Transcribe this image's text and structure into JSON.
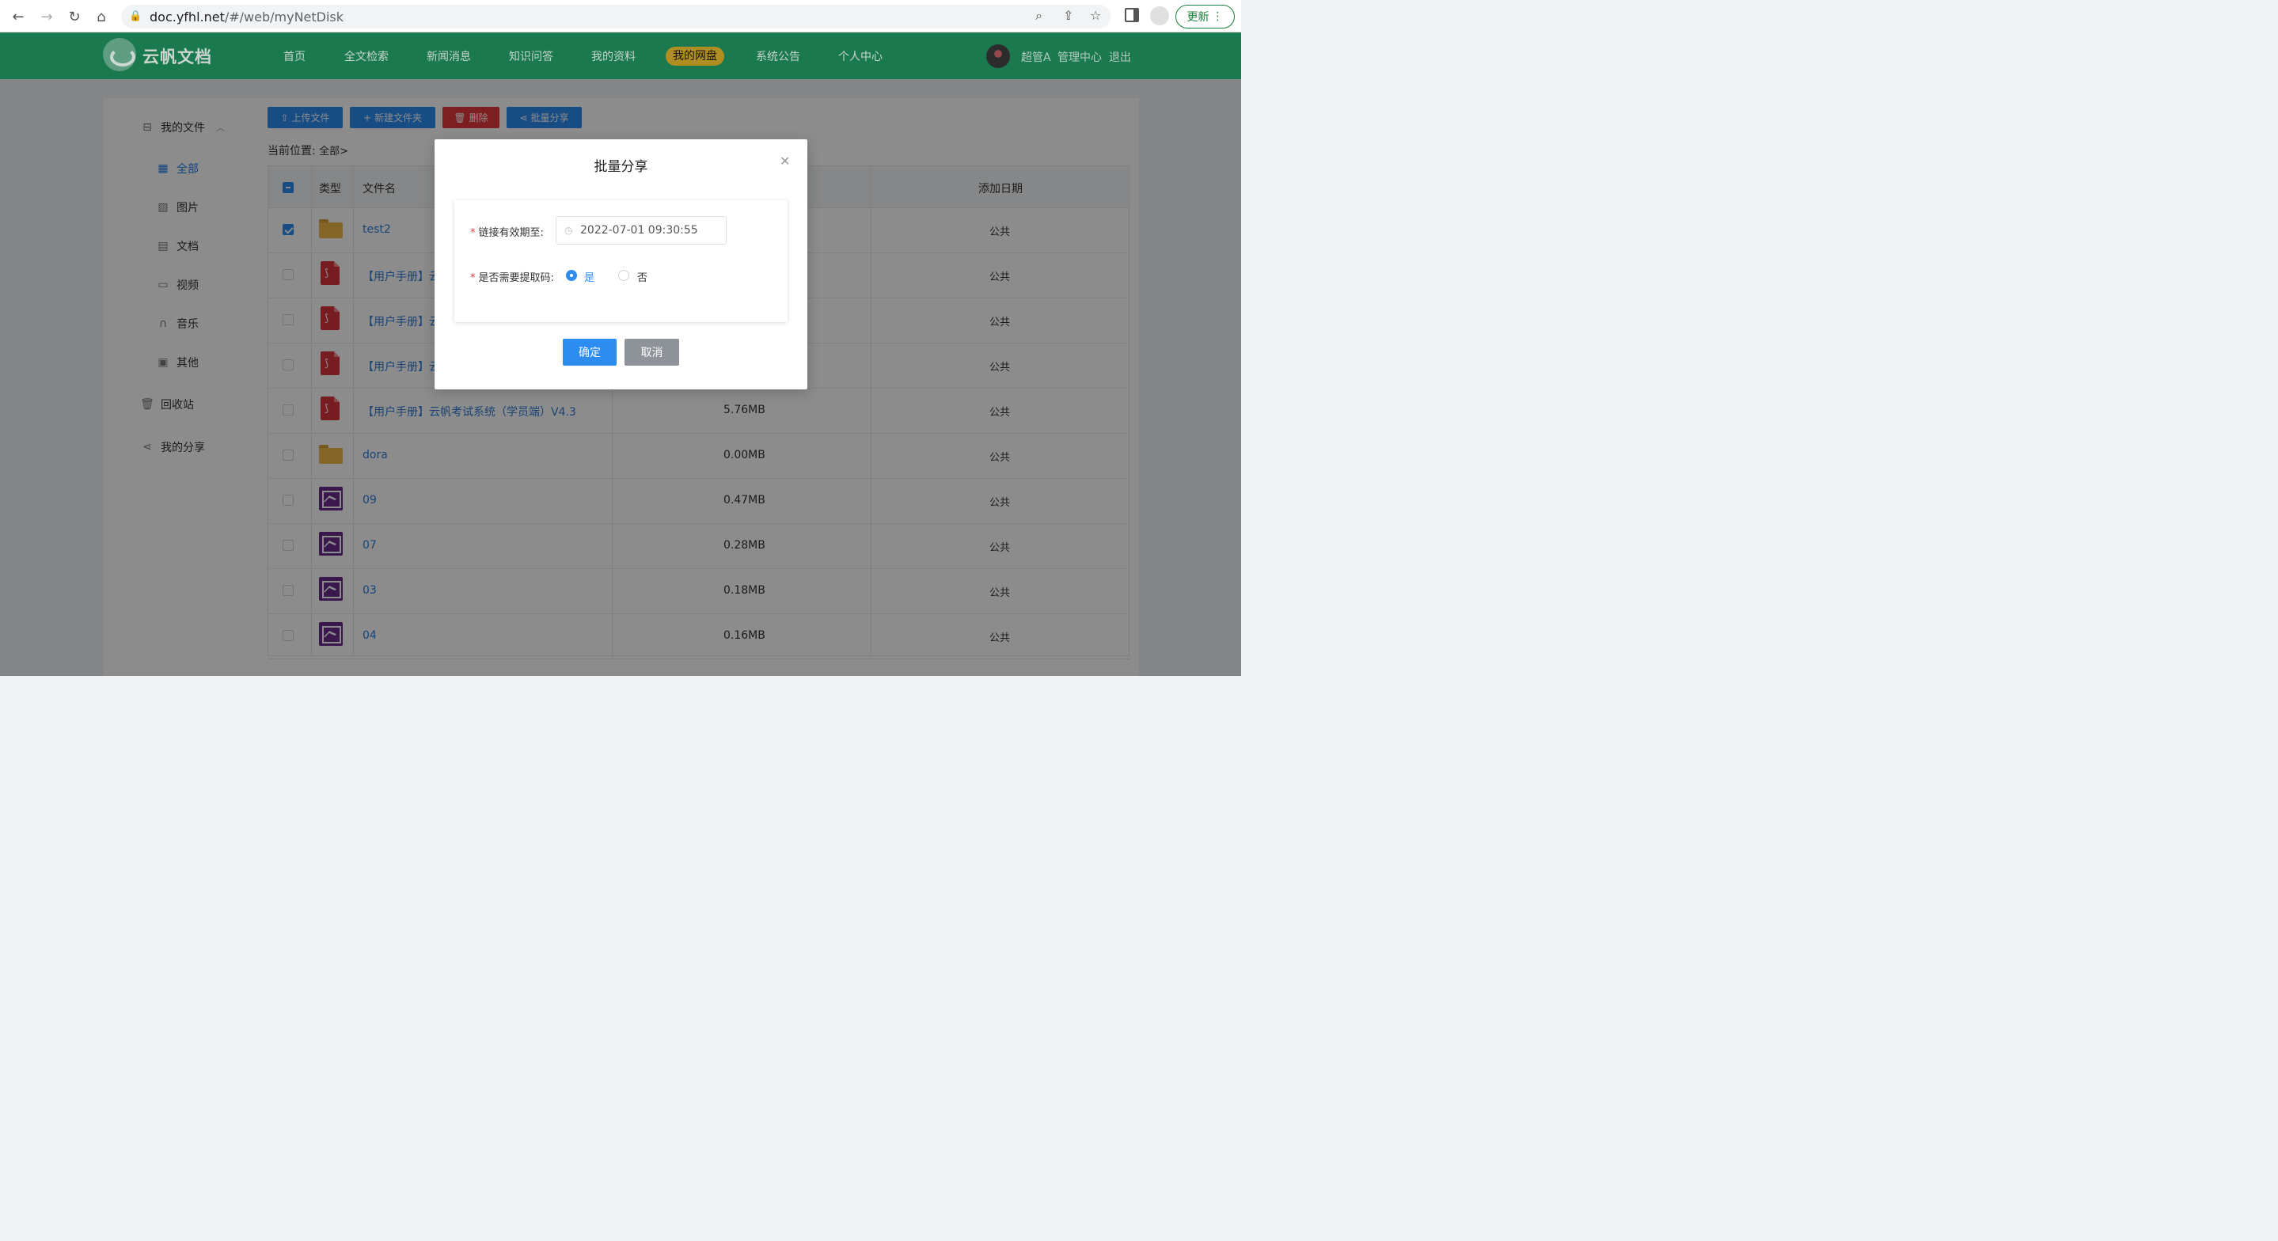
{
  "browser": {
    "url_host": "doc.yfhl.net",
    "url_path": "/#/web/myNetDisk",
    "update_label": "更新"
  },
  "site": {
    "logo_text": "云帆文档",
    "nav": [
      "首页",
      "全文检索",
      "新闻消息",
      "知识问答",
      "我的资料",
      "我的网盘",
      "系统公告",
      "个人中心"
    ],
    "active_nav": "我的网盘",
    "user_name": "超管A",
    "admin_link": "管理中心",
    "logout_link": "退出"
  },
  "sidebar": {
    "my_files": "我的文件",
    "items": [
      "全部",
      "图片",
      "文档",
      "视频",
      "音乐",
      "其他"
    ],
    "recycle": "回收站",
    "my_share": "我的分享"
  },
  "toolbar": {
    "upload": "上传文件",
    "new_folder": "新建文件夹",
    "delete": "删除",
    "batch_share": "批量分享"
  },
  "breadcrumb": {
    "label": "当前位置:",
    "path": "全部>"
  },
  "table": {
    "headers": {
      "type": "类型",
      "name": "文件名",
      "date": "添加日期"
    },
    "rows": [
      {
        "icon": "folder-icon",
        "name": "test2",
        "size": "",
        "date": "公共",
        "checked": true
      },
      {
        "icon": "pdf-icon",
        "name": "【用户手册】云",
        "size": "",
        "date": "公共",
        "checked": false
      },
      {
        "icon": "pdf-icon",
        "name": "【用户手册】云",
        "size": "",
        "date": "公共",
        "checked": false
      },
      {
        "icon": "pdf-icon",
        "name": "【用户手册】云",
        "size": "",
        "date": "公共",
        "checked": false
      },
      {
        "icon": "pdf-icon",
        "name": "【用户手册】云帆考试系统（学员端）V4.3",
        "size": "5.76MB",
        "date": "公共",
        "checked": false
      },
      {
        "icon": "folder-icon",
        "name": "dora",
        "size": "0.00MB",
        "date": "公共",
        "checked": false
      },
      {
        "icon": "image-icon",
        "name": "09",
        "size": "0.47MB",
        "date": "公共",
        "checked": false
      },
      {
        "icon": "image-icon",
        "name": "07",
        "size": "0.28MB",
        "date": "公共",
        "checked": false
      },
      {
        "icon": "image-icon",
        "name": "03",
        "size": "0.18MB",
        "date": "公共",
        "checked": false
      },
      {
        "icon": "image-icon",
        "name": "04",
        "size": "0.16MB",
        "date": "公共",
        "checked": false
      }
    ]
  },
  "modal": {
    "title": "批量分享",
    "expire_label": "链接有效期至:",
    "expire_value": "2022-07-01 09:30:55",
    "code_label": "是否需要提取码:",
    "yes": "是",
    "no": "否",
    "selected": "是",
    "ok": "确定",
    "cancel": "取消"
  }
}
